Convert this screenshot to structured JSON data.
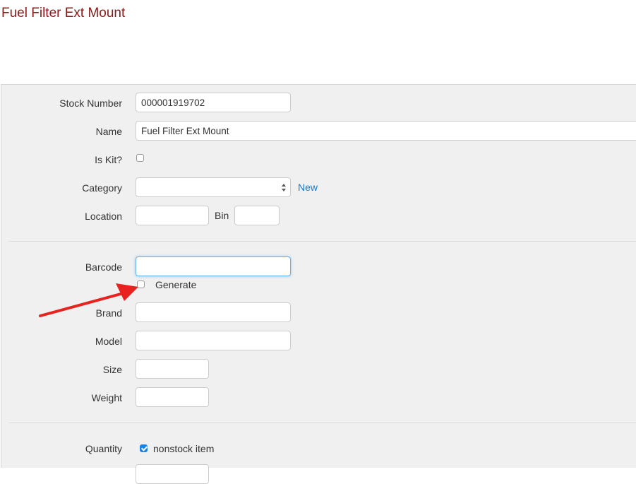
{
  "page": {
    "title": "Fuel Filter Ext Mount"
  },
  "form": {
    "stock_number": {
      "label": "Stock Number",
      "value": "000001919702"
    },
    "name": {
      "label": "Name",
      "value": "Fuel Filter Ext Mount"
    },
    "is_kit": {
      "label": "Is Kit?",
      "checked": false
    },
    "category": {
      "label": "Category",
      "value": "",
      "new_link": "New"
    },
    "location": {
      "label": "Location",
      "value": "",
      "bin_label": "Bin",
      "bin_value": ""
    },
    "barcode": {
      "label": "Barcode",
      "value": "",
      "generate_label": "Generate",
      "generate_checked": false
    },
    "brand": {
      "label": "Brand",
      "value": ""
    },
    "model": {
      "label": "Model",
      "value": ""
    },
    "size": {
      "label": "Size",
      "value": ""
    },
    "weight": {
      "label": "Weight",
      "value": ""
    },
    "quantity": {
      "label": "Quantity",
      "nonstock_label": "nonstock item",
      "nonstock_checked": true
    }
  },
  "annotation": {
    "arrow_color": "#e8231f"
  },
  "colors": {
    "title": "#8b1a1a",
    "link": "#1a7ac8",
    "panel_bg": "#f0f0f0",
    "checkbox_checked": "#1a82e2"
  }
}
